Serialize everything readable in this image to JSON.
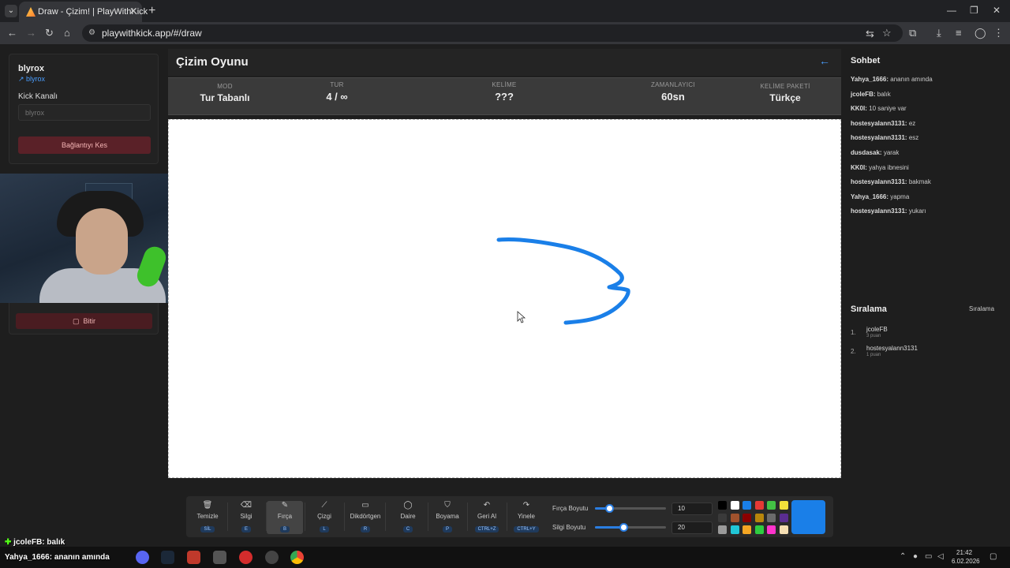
{
  "browser": {
    "tab_title": "Draw - Çizim! | PlayWithKick",
    "url": "playwithkick.app/#/draw"
  },
  "left_panel": {
    "username": "blyrox",
    "user_link": "↗ blyrox",
    "kick_label": "Kick Kanalı",
    "kick_placeholder": "blyrox",
    "disconnect_label": "Bağlantıyı Kes",
    "finish_label": "Bitir"
  },
  "main": {
    "title": "Çizim Oyunu",
    "info": {
      "mode_label": "MOD",
      "mode_value": "Tur Tabanlı",
      "round_label": "TUR",
      "round_value": "4 / ∞",
      "word_label": "KELİME",
      "word_value": "???",
      "timer_label": "ZAMANLAYICI",
      "timer_value": "60sn",
      "pack_label": "KELİME PAKETİ",
      "pack_value": "Türkçe"
    },
    "brush_color": "#1a7fe8"
  },
  "toolbar": {
    "tools": [
      {
        "label": "Temizle",
        "key": "SİL",
        "icon": "trash-icon"
      },
      {
        "label": "Silgi",
        "key": "E",
        "icon": "eraser-icon"
      },
      {
        "label": "Fırça",
        "key": "B",
        "icon": "brush-icon"
      },
      {
        "label": "Çizgi",
        "key": "L",
        "icon": "line-icon"
      },
      {
        "label": "Dikdörtgen",
        "key": "R",
        "icon": "rectangle-icon"
      },
      {
        "label": "Daire",
        "key": "C",
        "icon": "circle-icon"
      },
      {
        "label": "Boyama",
        "key": "P",
        "icon": "fill-bucket-icon"
      },
      {
        "label": "Geri Al",
        "key": "CTRL+Z",
        "icon": "undo-icon"
      },
      {
        "label": "Yinele",
        "key": "CTRL+Y",
        "icon": "redo-icon"
      }
    ],
    "active_tool": "Fırça",
    "brush_size_label": "Fırça Boyutu",
    "brush_size_value": "10",
    "brush_size_level": 0.2,
    "eraser_size_label": "Silgi Boyutu",
    "eraser_size_value": "20",
    "eraser_size_level": 0.4,
    "palette": [
      "#000000",
      "#ffffff",
      "#1a7fe8",
      "#e53935",
      "#43c144",
      "#f3e13a",
      "#3a3a3a",
      "#a0522d",
      "#8b0000",
      "#b8860b",
      "#6b6b6b",
      "#5a2d91",
      "#9a9a9a",
      "#21c6d6",
      "#f5a623",
      "#2ecc40",
      "#ff33cc",
      "#f5deb3"
    ],
    "current_color": "#1a7fe8"
  },
  "chat": {
    "title": "Sohbet",
    "messages": [
      {
        "user": "Yahya_1666:",
        "text": "ananın amında"
      },
      {
        "user": "jcoleFB:",
        "text": "balık"
      },
      {
        "user": "KK0I:",
        "text": "10 saniye var"
      },
      {
        "user": "hostesyalann3131:",
        "text": "ez"
      },
      {
        "user": "hostesyalann3131:",
        "text": "esz"
      },
      {
        "user": "dusdasak:",
        "text": "yarak"
      },
      {
        "user": "KK0I:",
        "text": "yahya ibnesini"
      },
      {
        "user": "hostesyalann3131:",
        "text": "bakmak"
      },
      {
        "user": "Yahya_1666:",
        "text": "yapma"
      },
      {
        "user": "hostesyalann3131:",
        "text": "yukarı"
      }
    ]
  },
  "ranking": {
    "title": "Sıralama",
    "link": "Sıralama",
    "rows": [
      {
        "rank": "1.",
        "name": "jcoleFB",
        "points": "3 puan"
      },
      {
        "rank": "2.",
        "name": "hostesyalann3131",
        "points": "1 puan"
      }
    ]
  },
  "stream_overlay": {
    "line1_user": "jcoleFB",
    "line1_text": ": balık",
    "line2_user": "Yahya_1666",
    "line2_text": ": ananın amında"
  },
  "taskbar": {
    "time": "21:42",
    "date": "6.02.2026"
  }
}
